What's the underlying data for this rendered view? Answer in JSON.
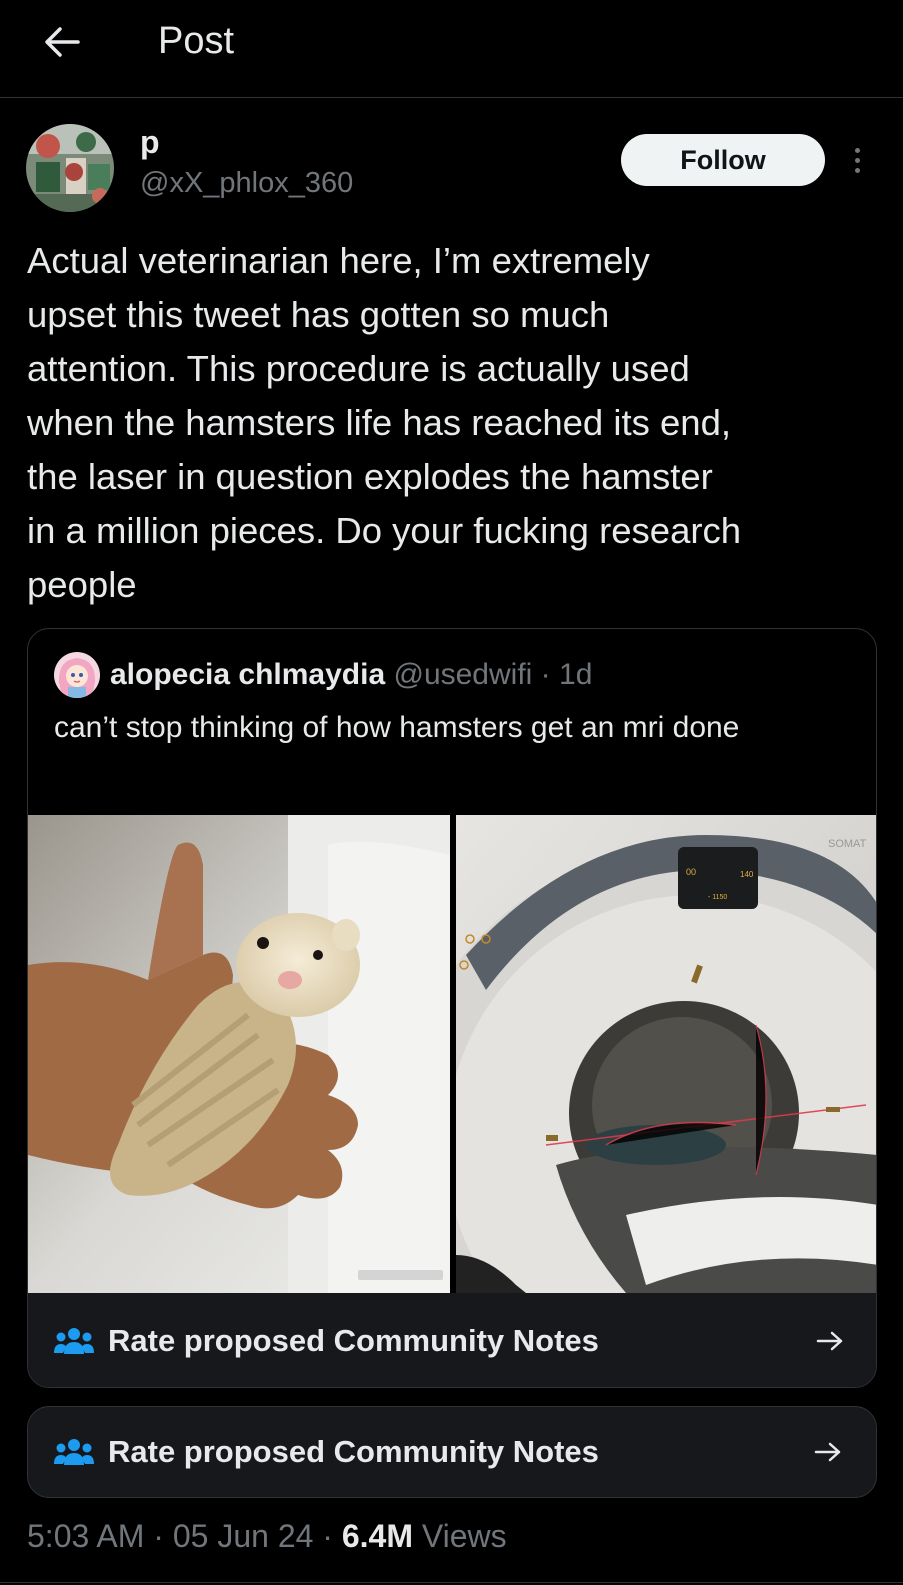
{
  "header": {
    "title": "Post"
  },
  "post": {
    "display_name": "p",
    "handle": "@xX_phlox_360",
    "follow_label": "Follow",
    "text": "Actual veterinarian here, I’m extremely\nupset this tweet has gotten so much\nattention. This procedure is actually used\nwhen the hamsters life has reached its end,\nthe laser in question explodes the hamster\nin a million pieces. Do your fucking research\npeople"
  },
  "quote": {
    "display_name": "alopecia chlmaydia",
    "handle": "@usedwifi",
    "separator": "·",
    "time": "1d",
    "text": "can’t stop thinking of how hamsters get an mri done",
    "scanner_brand": "SOMAT",
    "scanner_readout_left": "00",
    "scanner_readout_right": "140",
    "scanner_readout_center": "- 1150"
  },
  "community_notes": {
    "inner_label": "Rate proposed Community Notes",
    "outer_label": "Rate proposed Community Notes"
  },
  "meta": {
    "time": "5:03 AM",
    "sep1": "·",
    "date": "05 Jun 24",
    "sep2": "·",
    "views_count": "6.4M",
    "views_label": "Views"
  },
  "icons": {
    "back": "arrow-left-icon",
    "more": "more-vertical-icon",
    "notes": "community-notes-icon",
    "arrow": "arrow-right-icon"
  },
  "colors": {
    "background": "#000000",
    "text_primary": "#e7e9ea",
    "text_secondary": "#71767b",
    "border": "#2f3336",
    "card_bg": "#16181c",
    "follow_bg": "#eff3f4"
  }
}
